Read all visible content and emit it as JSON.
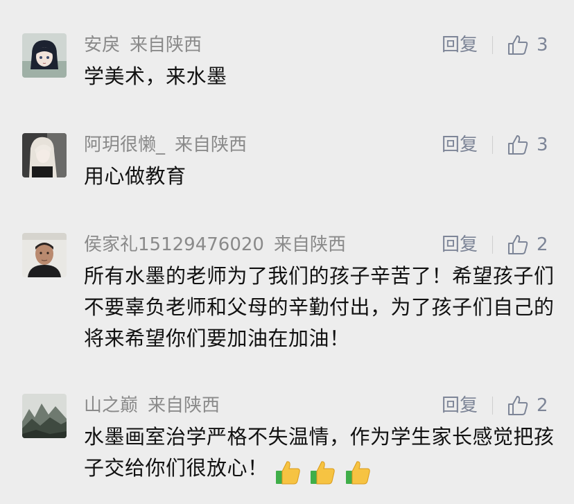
{
  "comments": [
    {
      "username": "安戾",
      "region": "来自陕西",
      "reply_label": "回复",
      "likes": "3",
      "text": "学美术，来水墨",
      "avatar": "anime-girl-avatar"
    },
    {
      "username": "阿玥很懒_",
      "region": "来自陕西",
      "reply_label": "回复",
      "likes": "3",
      "text": "用心做教育",
      "avatar": "blonde-girl-avatar"
    },
    {
      "username": "侯家礼15129476020",
      "region": "来自陕西",
      "reply_label": "回复",
      "likes": "2",
      "text": "所有水墨的老师为了我们的孩子辛苦了！希望孩子们不要辜负老师和父母的辛勤付出，为了孩子们自己的将来希望你们要加油在加油！",
      "avatar": "man-portrait-avatar"
    },
    {
      "username": "山之巅",
      "region": "来自陕西",
      "reply_label": "回复",
      "likes": "2",
      "text": "水墨画室治学严格不失温情，作为学生家长感觉把孩子交给你们很放心！",
      "avatar": "mountain-landscape-avatar",
      "emojis": [
        "thumbs-up-emoji",
        "thumbs-up-emoji",
        "thumbs-up-emoji"
      ]
    }
  ],
  "colors": {
    "background": "#ededed",
    "meta_text": "#8a8a8a",
    "action_text": "#7d8597",
    "body_text": "#111111"
  }
}
